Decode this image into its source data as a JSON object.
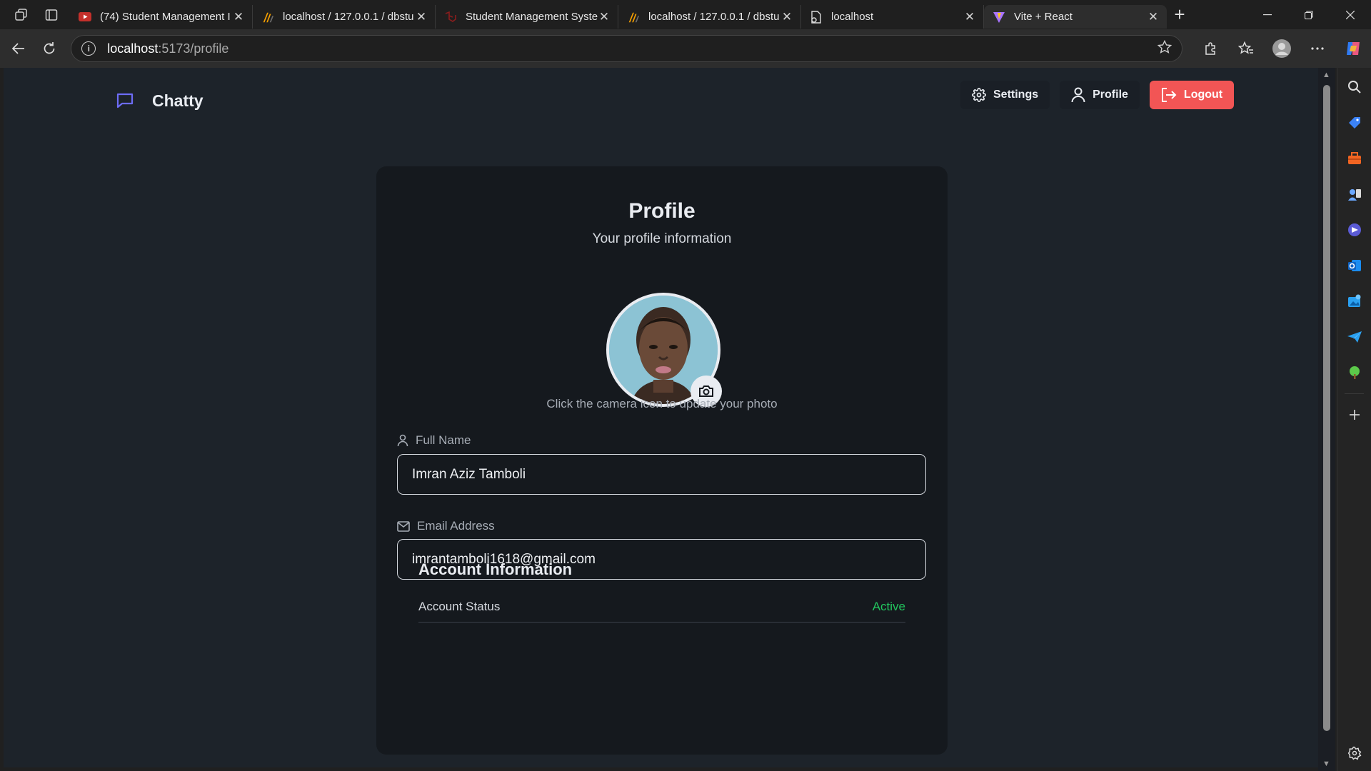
{
  "browser": {
    "tabs": [
      {
        "title": "(74) Student Management I",
        "favicon": "youtube-icon",
        "active": false
      },
      {
        "title": "localhost / 127.0.0.1 / dbstu",
        "favicon": "phpmyadmin-icon",
        "active": false
      },
      {
        "title": "Student Management Syste",
        "favicon": "laravel-icon",
        "active": false
      },
      {
        "title": "localhost / 127.0.0.1 / dbstu",
        "favicon": "phpmyadmin-icon",
        "active": false
      },
      {
        "title": "localhost",
        "favicon": "document-icon",
        "active": false
      },
      {
        "title": "Vite + React",
        "favicon": "vite-icon",
        "active": true
      }
    ],
    "url_host": "localhost",
    "url_path": ":5173/profile"
  },
  "app": {
    "brand": "Chatty",
    "nav": {
      "settings": "Settings",
      "profile": "Profile",
      "logout": "Logout"
    }
  },
  "profile": {
    "title": "Profile",
    "subtitle": "Your profile information",
    "avatar_hint": "Click the camera icon to update your photo",
    "full_name_label": "Full Name",
    "full_name_value": "Imran Aziz Tamboli",
    "email_label": "Email Address",
    "email_value": "imrantamboli1618@gmail.com"
  },
  "account": {
    "title": "Account Information",
    "status_label": "Account Status",
    "status_value": "Active"
  },
  "colors": {
    "accent": "#6d6cf6",
    "logout_bg": "#f25555",
    "active_green": "#22c55e",
    "page_bg": "#1d232a",
    "card_bg": "#15191e"
  }
}
